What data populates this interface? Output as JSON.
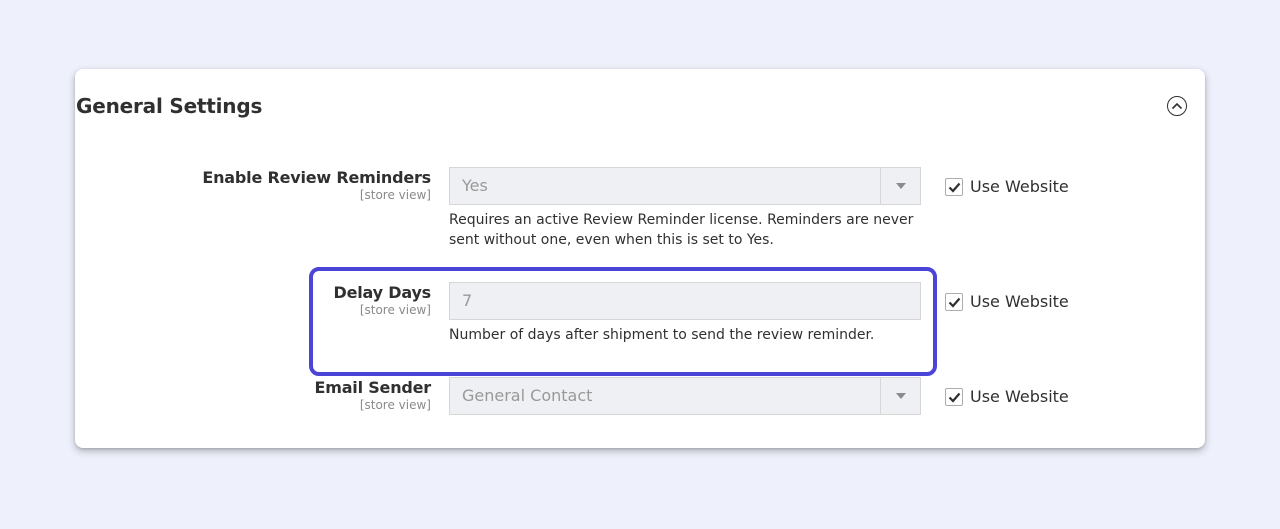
{
  "section": {
    "title": "General Settings",
    "collapse_icon": "chevron-up-circle-icon"
  },
  "fields": {
    "enable_reminders": {
      "label": "Enable Review Reminders",
      "scope": "[store view]",
      "value": "Yes",
      "note": "Requires an active Review Reminder license. Reminders are never sent without one, even when this is set to Yes.",
      "use_website_label": "Use Website",
      "use_website_checked": true
    },
    "delay_days": {
      "label": "Delay Days",
      "scope": "[store view]",
      "value": "7",
      "note": "Number of days after shipment to send the review reminder.",
      "use_website_label": "Use Website",
      "use_website_checked": true
    },
    "email_sender": {
      "label": "Email Sender",
      "scope": "[store view]",
      "value": "General Contact",
      "use_website_label": "Use Website",
      "use_website_checked": true
    }
  },
  "colors": {
    "highlight": "#4a45d6",
    "background": "#eef0fb",
    "disabled_field": "#eff0f3"
  }
}
